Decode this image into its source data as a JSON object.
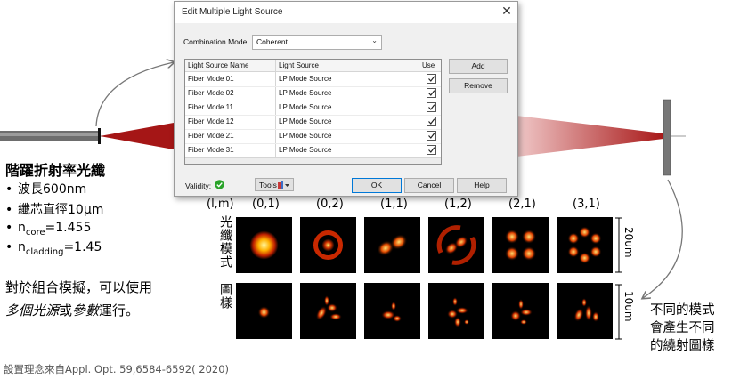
{
  "dialog": {
    "title": "Edit Multiple Light Source",
    "close_glyph": "✕",
    "combination_mode_label": "Combination Mode",
    "combination_mode_value": "Coherent",
    "columns": [
      "Light Source Name",
      "Light Source",
      "Use"
    ],
    "rows": [
      {
        "name": "Fiber Mode 01",
        "source": "LP Mode Source",
        "use": true
      },
      {
        "name": "Fiber Mode 02",
        "source": "LP Mode Source",
        "use": true
      },
      {
        "name": "Fiber Mode 11",
        "source": "LP Mode Source",
        "use": true
      },
      {
        "name": "Fiber Mode 12",
        "source": "LP Mode Source",
        "use": true
      },
      {
        "name": "Fiber Mode 21",
        "source": "LP Mode Source",
        "use": true
      },
      {
        "name": "Fiber Mode 31",
        "source": "LP Mode Source",
        "use": true
      }
    ],
    "add_label": "Add",
    "remove_label": "Remove",
    "validity_label": "Validity:",
    "tools_label": "Tools",
    "ok_label": "OK",
    "cancel_label": "Cancel",
    "help_label": "Help",
    "accent_color": "#0078d7"
  },
  "fiber": {
    "heading": "階躍折射率光纖",
    "bullets": [
      {
        "prefix": "波長600nm"
      },
      {
        "prefix": "纖芯直徑10μm"
      },
      {
        "prefix": "n",
        "sub": "core",
        "suffix": "=1.455"
      },
      {
        "prefix": "n",
        "sub": "cladding",
        "suffix": "=1.45"
      }
    ],
    "note_line1": "對於組合模擬，可以使用",
    "note_line2_a": "多個光源",
    "note_line2_b": "或",
    "note_line2_c": "參數",
    "note_line2_d": "運行。"
  },
  "modes": {
    "header_label": "(l,m)",
    "labels": [
      "(0,1)",
      "(0,2)",
      "(1,1)",
      "(1,2)",
      "(2,1)",
      "(3,1)"
    ],
    "row1_label": "光纖模式",
    "row2_label": "圖樣",
    "scale1": "20um",
    "scale2": "10um",
    "beam_color": "#b01c1c"
  },
  "caption": {
    "line1": "不同的模式",
    "line2": "會產生不同",
    "line3": "的繞射圖樣"
  },
  "reference": "設置理念來自Appl. Opt. 59,6584-6592( 2020)"
}
